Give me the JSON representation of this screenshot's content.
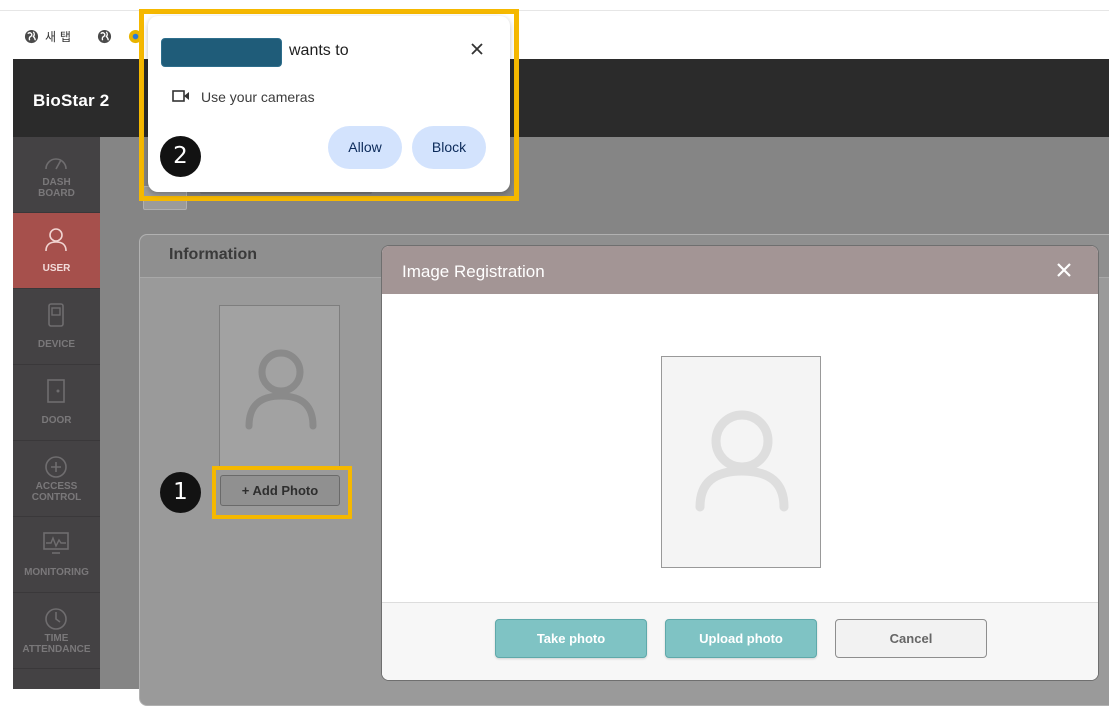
{
  "browser": {
    "tabs": [
      {
        "label": "새 탭"
      }
    ]
  },
  "app": {
    "logo": "BioStar 2"
  },
  "sidebar": {
    "items": [
      {
        "label_line1": "DASH",
        "label_line2": "BOARD",
        "icon": "gauge-icon",
        "active": false
      },
      {
        "label_line1": "USER",
        "label_line2": "",
        "icon": "user-icon",
        "active": true
      },
      {
        "label_line1": "DEVICE",
        "label_line2": "",
        "icon": "device-icon",
        "active": false
      },
      {
        "label_line1": "DOOR",
        "label_line2": "",
        "icon": "door-icon",
        "active": false
      },
      {
        "label_line1": "ACCESS",
        "label_line2": "CONTROL",
        "icon": "shield-plus-icon",
        "active": false
      },
      {
        "label_line1": "MONITORING",
        "label_line2": "",
        "icon": "monitor-pulse-icon",
        "active": false
      },
      {
        "label_line1": "TIME",
        "label_line2": "ATTENDANCE",
        "icon": "clock-icon",
        "active": false
      }
    ]
  },
  "info_panel": {
    "title": "Information",
    "add_photo_label": "+ Add Photo"
  },
  "modal": {
    "title": "Image Registration",
    "buttons": {
      "take_photo": "Take photo",
      "upload_photo": "Upload photo",
      "cancel": "Cancel"
    }
  },
  "permission_prompt": {
    "wants_to": "wants to",
    "permission": "Use your cameras",
    "allow": "Allow",
    "block": "Block"
  },
  "annotations": {
    "step1": "1",
    "step2": "2",
    "highlight_color": "#f5b800"
  },
  "colors": {
    "active_nav": "#a6504c",
    "modal_header": "#a39595",
    "teal_button": "#7fc3c4",
    "prompt_button": "#d3e3fd"
  }
}
